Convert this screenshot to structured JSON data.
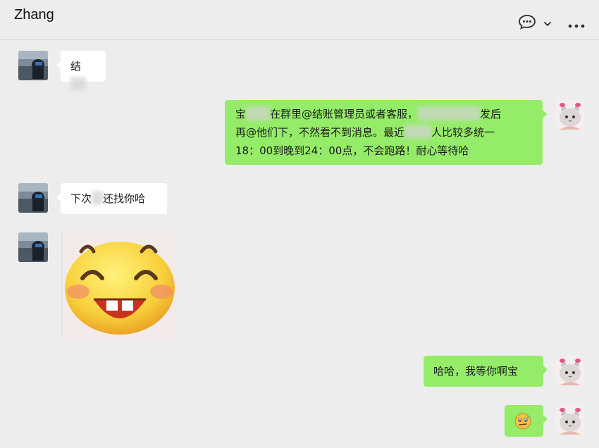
{
  "header": {
    "title": "Zhang",
    "icons": [
      "chat-bubble-icon",
      "chevron-down-icon",
      "more-icon"
    ]
  },
  "messages": [
    {
      "side": "in",
      "text": "结",
      "redacted": true
    },
    {
      "side": "out",
      "lines": [
        {
          "a": "宝",
          "b": "在群里@结账管理员或者客服，",
          "c": "发后"
        },
        {
          "a": "再@他们下，不然看不到消息。最近",
          "b": "人比较多统一"
        },
        {
          "a": "18：00到晚到24：00点，不会跑路！耐心等待哈"
        }
      ]
    },
    {
      "side": "in",
      "a": "下次",
      "b": "还找你哈"
    },
    {
      "side": "in",
      "type": "sticker",
      "sticker": "grinning-emoji-sticker"
    },
    {
      "side": "out",
      "text": "哈哈，我等你啊宝"
    },
    {
      "side": "out",
      "type": "emoji",
      "emoji": "awkward-smile-emoji"
    }
  ],
  "colors": {
    "background": "#ededed",
    "bubble_in": "#ffffff",
    "bubble_out": "#95ec69"
  }
}
